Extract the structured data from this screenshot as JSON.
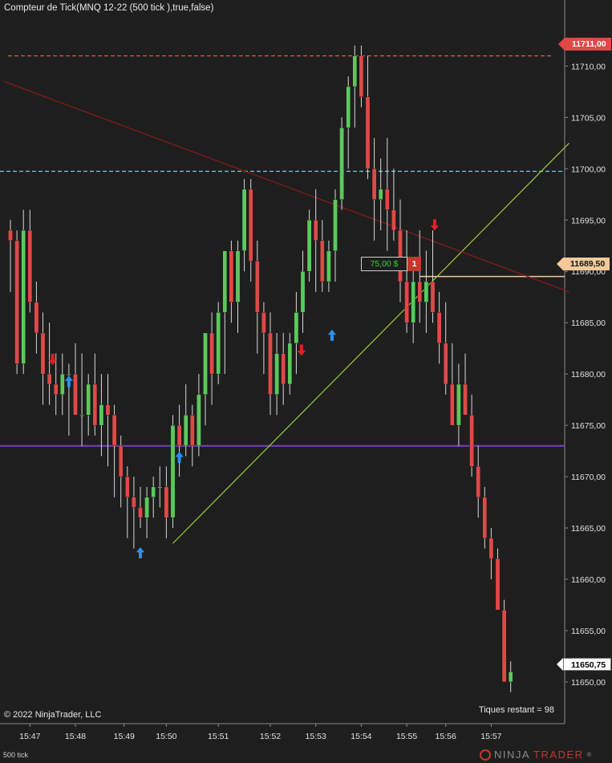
{
  "chart_title": "Compteur de Tick(MNQ 12-22 (500 tick ),true,false)",
  "copyright": "© 2022 NinjaTrader, LLC",
  "ticks_remaining": "Tiques restant = 98",
  "bar_type": "500 tick",
  "brand": {
    "ninja": "NINJA",
    "trader": "TRADER",
    "suffix": "®"
  },
  "price_tags": {
    "high_line": "11711,00",
    "position_line": "11689,50",
    "last_price": "11650,75"
  },
  "order": {
    "pnl": "75,00 $",
    "quantity": "1"
  },
  "colors": {
    "background": "#1e1e1e",
    "up_candle": "#5cc85c",
    "down_candle": "#e04848",
    "high_line": "#e05555",
    "cyan_line": "#7ec8e8",
    "purple_line": "#7a3fc2",
    "position_line": "#f1c99b",
    "trend_up": "#9acd32",
    "trend_down": "#8b1a1a"
  },
  "chart_data": {
    "type": "candlestick",
    "y_ticks": [
      "11710,00",
      "11705,00",
      "11700,00",
      "11695,00",
      "11690,00",
      "11685,00",
      "11680,00",
      "11675,00",
      "11670,00",
      "11665,00",
      "11660,00",
      "11655,00",
      "11650,00"
    ],
    "y_tick_values": [
      11710,
      11705,
      11700,
      11695,
      11690,
      11685,
      11680,
      11675,
      11670,
      11665,
      11660,
      11655,
      11650
    ],
    "ylim": [
      11645.93,
      11716.44
    ],
    "x_ticks": [
      "15:47",
      "15:48",
      "15:49",
      "15:50",
      "15:51",
      "15:52",
      "15:53",
      "15:54",
      "15:55",
      "15:56",
      "15:57"
    ],
    "x_tick_bars": [
      3,
      10,
      17.5,
      24,
      32,
      40,
      47,
      54,
      61,
      67,
      74
    ],
    "horizontal_lines": [
      {
        "name": "high",
        "price": 11711.0
      },
      {
        "name": "cyan",
        "price": 11699.75
      },
      {
        "name": "purple",
        "price": 11673.0
      },
      {
        "name": "position",
        "price": 11689.5
      }
    ],
    "trend_lines": [
      {
        "name": "green-trend",
        "from": {
          "bar": 25,
          "price": 11663.5
        },
        "to": {
          "bar": 86,
          "price": 11702.5
        }
      },
      {
        "name": "maroon-trend",
        "from": {
          "bar": -1,
          "price": 11708.5
        },
        "to": {
          "bar": 86,
          "price": 11688.0
        }
      }
    ],
    "bars": [
      [
        11694,
        11695,
        11688,
        11693
      ],
      [
        11693,
        11694,
        11680,
        11681
      ],
      [
        11681,
        11696,
        11680,
        11694
      ],
      [
        11694,
        11696,
        11686,
        11687
      ],
      [
        11687,
        11689,
        11682,
        11684
      ],
      [
        11684,
        11686,
        11677,
        11680
      ],
      [
        11680,
        11685,
        11677,
        11679
      ],
      [
        11679,
        11682,
        11676,
        11678
      ],
      [
        11678,
        11682,
        11676,
        11680
      ],
      [
        11680,
        11681,
        11674,
        11680
      ],
      [
        11680,
        11683,
        11677,
        11676
      ],
      [
        11676,
        11682,
        11673,
        11676
      ],
      [
        11676,
        11680,
        11674,
        11679
      ],
      [
        11679,
        11682,
        11674,
        11675
      ],
      [
        11675,
        11680,
        11672,
        11677
      ],
      [
        11677,
        11680,
        11671,
        11676
      ],
      [
        11676,
        11677,
        11668,
        11673
      ],
      [
        11673,
        11674,
        11667,
        11670
      ],
      [
        11670,
        11671,
        11664,
        11668
      ],
      [
        11668,
        11670,
        11663,
        11667
      ],
      [
        11667,
        11669,
        11665,
        11666
      ],
      [
        11666,
        11669,
        11664,
        11668
      ],
      [
        11668,
        11670,
        11666,
        11669
      ],
      [
        11669,
        11671,
        11667,
        11669
      ],
      [
        11669,
        11671,
        11664,
        11666
      ],
      [
        11666,
        11676,
        11665,
        11675
      ],
      [
        11675,
        11677,
        11670,
        11673
      ],
      [
        11673,
        11679,
        11672,
        11676
      ],
      [
        11676,
        11677,
        11671,
        11673
      ],
      [
        11673,
        11680,
        11672,
        11678
      ],
      [
        11678,
        11684,
        11675,
        11684
      ],
      [
        11684,
        11686,
        11677,
        11680
      ],
      [
        11680,
        11687,
        11679,
        11686
      ],
      [
        11686,
        11692,
        11680,
        11692
      ],
      [
        11692,
        11693,
        11685,
        11687
      ],
      [
        11687,
        11693,
        11684,
        11692
      ],
      [
        11692,
        11699,
        11690,
        11698
      ],
      [
        11698,
        11699,
        11689,
        11691
      ],
      [
        11691,
        11693,
        11682,
        11686
      ],
      [
        11686,
        11687,
        11680,
        11684
      ],
      [
        11684,
        11686,
        11676,
        11678
      ],
      [
        11678,
        11684,
        11676,
        11682
      ],
      [
        11682,
        11684,
        11677,
        11679
      ],
      [
        11679,
        11684,
        11678,
        11683
      ],
      [
        11683,
        11688,
        11680,
        11686
      ],
      [
        11686,
        11692,
        11684,
        11690
      ],
      [
        11690,
        11696,
        11689,
        11695
      ],
      [
        11695,
        11698,
        11688,
        11693
      ],
      [
        11693,
        11695,
        11688,
        11689
      ],
      [
        11689,
        11693,
        11688,
        11692
      ],
      [
        11692,
        11698,
        11689,
        11697
      ],
      [
        11697,
        11705,
        11696,
        11704
      ],
      [
        11704,
        11709,
        11700,
        11708
      ],
      [
        11708,
        11712,
        11704,
        11711
      ],
      [
        11711,
        11712,
        11706,
        11707
      ],
      [
        11707,
        11711,
        11699,
        11700
      ],
      [
        11700,
        11703,
        11693,
        11697
      ],
      [
        11697,
        11701,
        11694,
        11698
      ],
      [
        11698,
        11703,
        11692,
        11696
      ],
      [
        11696,
        11700,
        11693,
        11694
      ],
      [
        11694,
        11697,
        11687,
        11689
      ],
      [
        11689,
        11694,
        11684,
        11685
      ],
      [
        11685,
        11691,
        11683,
        11689
      ],
      [
        11689,
        11694,
        11685,
        11687
      ],
      [
        11687,
        11692,
        11684,
        11689
      ],
      [
        11689,
        11694,
        11685,
        11686
      ],
      [
        11686,
        11688,
        11681,
        11683
      ],
      [
        11683,
        11687,
        11678,
        11679
      ],
      [
        11679,
        11683,
        11676,
        11675
      ],
      [
        11675,
        11681,
        11673,
        11679
      ],
      [
        11679,
        11682,
        11676,
        11676
      ],
      [
        11676,
        11678,
        11670,
        11671
      ],
      [
        11671,
        11673,
        11666,
        11668
      ],
      [
        11668,
        11669,
        11663,
        11664
      ],
      [
        11664,
        11665,
        11660,
        11662
      ],
      [
        11662,
        11663,
        11657,
        11657
      ],
      [
        11657,
        11658,
        11650,
        11650
      ],
      [
        11650,
        11652,
        11649,
        11651
      ]
    ]
  }
}
